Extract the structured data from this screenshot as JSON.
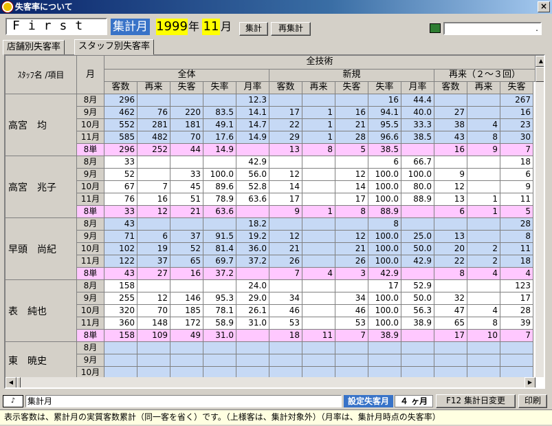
{
  "window": {
    "title": "失客率について",
    "close": "×"
  },
  "toolbar": {
    "store": "First",
    "period_label": "集計月",
    "year": "1999",
    "year_unit": "年",
    "month": "11",
    "month_unit": "月",
    "btn_aggregate": "集計",
    "btn_reaggregate": "再集計",
    "calc_value": "."
  },
  "tabs": [
    "店舗別失客率",
    "スタッフ別失客率"
  ],
  "header": {
    "name_col": "ｽﾀｯﾌ名 /項目",
    "month_col": "月",
    "group_all": "全技術",
    "sub_all": "全体",
    "sub_new": "新規",
    "sub_repeat": "再来（２～３回）",
    "cols_all": [
      "客数",
      "再来",
      "失客",
      "失率",
      "月率"
    ],
    "cols_new": [
      "客数",
      "再来",
      "失客",
      "失率",
      "月率"
    ],
    "cols_repeat": [
      "客数",
      "再来",
      "失客"
    ]
  },
  "staff": [
    {
      "name": "高宮　均",
      "rows": [
        {
          "m": "8月",
          "v": [
            "296",
            "",
            "",
            "",
            "12.3",
            "",
            "",
            "",
            "16",
            "44.4",
            "",
            "",
            "267"
          ]
        },
        {
          "m": "9月",
          "v": [
            "462",
            "76",
            "220",
            "83.5",
            "14.1",
            "17",
            "1",
            "16",
            "94.1",
            "40.0",
            "27",
            "",
            "16"
          ]
        },
        {
          "m": "10月",
          "v": [
            "552",
            "281",
            "181",
            "49.1",
            "14.7",
            "22",
            "1",
            "21",
            "95.5",
            "33.3",
            "38",
            "4",
            "23"
          ]
        },
        {
          "m": "11月",
          "v": [
            "585",
            "482",
            "70",
            "17.6",
            "14.9",
            "29",
            "1",
            "28",
            "96.6",
            "38.5",
            "43",
            "8",
            "30"
          ]
        },
        {
          "m": "8単",
          "v": [
            "296",
            "252",
            "44",
            "14.9",
            "",
            "13",
            "8",
            "5",
            "38.5",
            "",
            "16",
            "9",
            "7"
          ]
        }
      ]
    },
    {
      "name": "高宮　兆子",
      "rows": [
        {
          "m": "8月",
          "v": [
            "33",
            "",
            "",
            "",
            "42.9",
            "",
            "",
            "",
            "6",
            "66.7",
            "",
            "",
            "18"
          ]
        },
        {
          "m": "9月",
          "v": [
            "52",
            "",
            "33",
            "100.0",
            "56.0",
            "12",
            "",
            "12",
            "100.0",
            "100.0",
            "9",
            "",
            "6"
          ]
        },
        {
          "m": "10月",
          "v": [
            "67",
            "7",
            "45",
            "89.6",
            "52.8",
            "14",
            "",
            "14",
            "100.0",
            "80.0",
            "12",
            "",
            "9"
          ]
        },
        {
          "m": "11月",
          "v": [
            "76",
            "16",
            "51",
            "78.9",
            "63.6",
            "17",
            "",
            "17",
            "100.0",
            "88.9",
            "13",
            "1",
            "11"
          ]
        },
        {
          "m": "8単",
          "v": [
            "33",
            "12",
            "21",
            "63.6",
            "",
            "9",
            "1",
            "8",
            "88.9",
            "",
            "6",
            "1",
            "5"
          ]
        }
      ]
    },
    {
      "name": "早頭　尚紀",
      "rows": [
        {
          "m": "8月",
          "v": [
            "43",
            "",
            "",
            "",
            "18.2",
            "",
            "",
            "",
            "8",
            "",
            "",
            "",
            "28"
          ]
        },
        {
          "m": "9月",
          "v": [
            "71",
            "6",
            "37",
            "91.5",
            "19.2",
            "12",
            "",
            "12",
            "100.0",
            "25.0",
            "13",
            "",
            "8"
          ]
        },
        {
          "m": "10月",
          "v": [
            "102",
            "19",
            "52",
            "81.4",
            "36.0",
            "21",
            "",
            "21",
            "100.0",
            "50.0",
            "20",
            "2",
            "11"
          ]
        },
        {
          "m": "11月",
          "v": [
            "122",
            "37",
            "65",
            "69.7",
            "37.2",
            "26",
            "",
            "26",
            "100.0",
            "42.9",
            "22",
            "2",
            "18"
          ]
        },
        {
          "m": "8単",
          "v": [
            "43",
            "27",
            "16",
            "37.2",
            "",
            "7",
            "4",
            "3",
            "42.9",
            "",
            "8",
            "4",
            "4"
          ]
        }
      ]
    },
    {
      "name": "表　純也",
      "rows": [
        {
          "m": "8月",
          "v": [
            "158",
            "",
            "",
            "",
            "24.0",
            "",
            "",
            "",
            "17",
            "52.9",
            "",
            "",
            "123"
          ]
        },
        {
          "m": "9月",
          "v": [
            "255",
            "12",
            "146",
            "95.3",
            "29.0",
            "34",
            "",
            "34",
            "100.0",
            "50.0",
            "32",
            "",
            "17"
          ]
        },
        {
          "m": "10月",
          "v": [
            "320",
            "70",
            "185",
            "78.1",
            "26.1",
            "46",
            "",
            "46",
            "100.0",
            "56.3",
            "47",
            "4",
            "28"
          ]
        },
        {
          "m": "11月",
          "v": [
            "360",
            "148",
            "172",
            "58.9",
            "31.0",
            "53",
            "",
            "53",
            "100.0",
            "38.9",
            "65",
            "8",
            "39"
          ]
        },
        {
          "m": "8単",
          "v": [
            "158",
            "109",
            "49",
            "31.0",
            "",
            "18",
            "11",
            "7",
            "38.9",
            "",
            "17",
            "10",
            "7"
          ]
        }
      ]
    },
    {
      "name": "東　暁史",
      "rows": [
        {
          "m": "8月",
          "v": [
            "",
            "",
            "",
            "",
            "",
            "",
            "",
            "",
            "",
            "",
            "",
            "",
            ""
          ]
        },
        {
          "m": "9月",
          "v": [
            "",
            "",
            "",
            "",
            "",
            "",
            "",
            "",
            "",
            "",
            "",
            "",
            ""
          ]
        },
        {
          "m": "10月",
          "v": [
            "",
            "",
            "",
            "",
            "",
            "",
            "",
            "",
            "",
            "",
            "",
            "",
            ""
          ]
        }
      ]
    }
  ],
  "status": {
    "icon": "♪",
    "field": "集計月",
    "setting_label": "設定失客月",
    "months": "４ ヶ月",
    "btn_f12": "F12 集計日変更",
    "btn_print": "印刷"
  },
  "info": "表示客数は、累計月の実質客数累計（同一客を省く）です。（上様客は、集計対象外）（月率は、集計月時点の失客率）",
  "colors": {
    "blue_row": "#c6d9f5",
    "pink_row": "#ffc8ff",
    "header_blue": "#3873c8",
    "highlight_yellow": "#ffff00"
  }
}
